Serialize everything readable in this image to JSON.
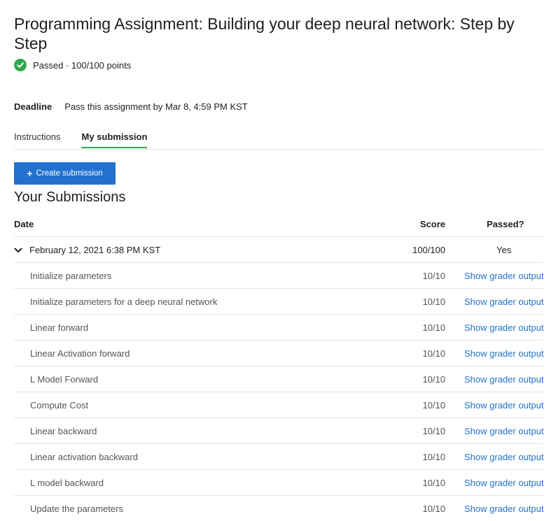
{
  "assignment": {
    "title": "Programming Assignment: Building your deep neural network: Step by Step",
    "status": "Passed · 100/100 points"
  },
  "deadline": {
    "label": "Deadline",
    "value": "Pass this assignment by Mar 8, 4:59 PM KST"
  },
  "tabs": [
    {
      "label": "Instructions",
      "active": false
    },
    {
      "label": "My submission",
      "active": true
    }
  ],
  "create_button": {
    "label": "Create submission"
  },
  "submissions": {
    "title": "Your Submissions",
    "columns": {
      "date": "Date",
      "score": "Score",
      "passed": "Passed?"
    },
    "submission": {
      "date": "February 12, 2021 6:38 PM KST",
      "score": "100/100",
      "passed": "Yes"
    },
    "link_label": "Show grader output",
    "parts": [
      {
        "name": "Initialize parameters",
        "score": "10/10"
      },
      {
        "name": "Initialize parameters for a deep neural network",
        "score": "10/10"
      },
      {
        "name": "Linear forward",
        "score": "10/10"
      },
      {
        "name": "Linear Activation forward",
        "score": "10/10"
      },
      {
        "name": "L Model Forward",
        "score": "10/10"
      },
      {
        "name": "Compute Cost",
        "score": "10/10"
      },
      {
        "name": "Linear backward",
        "score": "10/10"
      },
      {
        "name": "Linear activation backward",
        "score": "10/10"
      },
      {
        "name": "L model backward",
        "score": "10/10"
      },
      {
        "name": "Update the parameters",
        "score": "10/10"
      }
    ]
  },
  "colors": {
    "accent_blue": "#2172cf",
    "success_green": "#2fa84f"
  }
}
